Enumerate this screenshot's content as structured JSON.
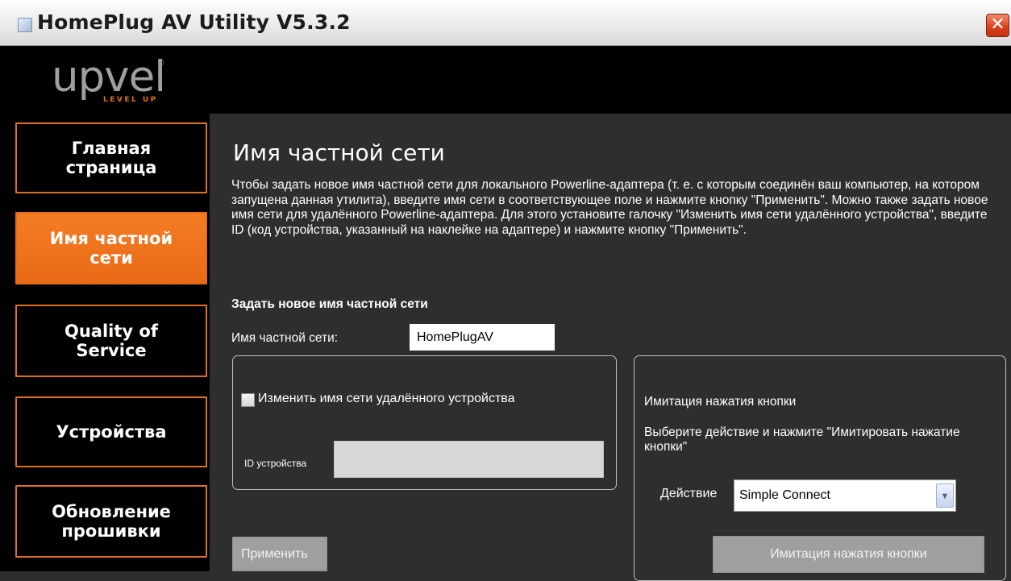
{
  "window": {
    "title": "HomePlug AV Utility V5.3.2",
    "close_symbol": "✕",
    "app_icon": "app-icon"
  },
  "brand": {
    "logo_text": "upvel",
    "logo_reg": "®",
    "logo_tagline": "LEVEL UP",
    "accent_color": "#f47d24"
  },
  "sidebar": {
    "items": [
      {
        "label": "Главная\nстраница",
        "active": false
      },
      {
        "label": "Имя частной\nсети",
        "active": true
      },
      {
        "label": "Quality of\nService",
        "active": false
      },
      {
        "label": "Устройства",
        "active": false
      },
      {
        "label": "Обновление\nпрошивки",
        "active": false
      }
    ]
  },
  "main": {
    "title": "Имя частной сети",
    "description": "Чтобы задать новое имя частной сети для локального Powerline-адаптера (т. е. с которым соединён ваш компьютер, на котором запущена данная утилита), введите имя сети в соответствующее поле и нажмите кнопку \"Применить\". Можно также задать новое имя сети для удалённого Powerline-адаптера. Для этого установите галочку \"Изменить имя сети удалённого устройства\", введите ID (код устройства, указанный на наклейке на адаптере) и нажмите кнопку \"Применить\".",
    "section_title": "Задать новое имя частной сети",
    "network_name_label": "Имя частной сети:",
    "network_name_value": "HomePlugAV",
    "remote": {
      "checkbox_label": "Изменить имя сети удалённого устройства",
      "checked": false,
      "device_id_label": "ID устройства",
      "device_id_value": ""
    },
    "apply_button": "Применить",
    "push_button": {
      "title": "Имитация нажатия кнопки",
      "description": "Выберите действие и нажмите \"Имитировать нажатие кнопки\"",
      "action_label": "Действие",
      "action_value": "Simple Connect",
      "simulate_button": "Имитация нажатия кнопки"
    }
  }
}
